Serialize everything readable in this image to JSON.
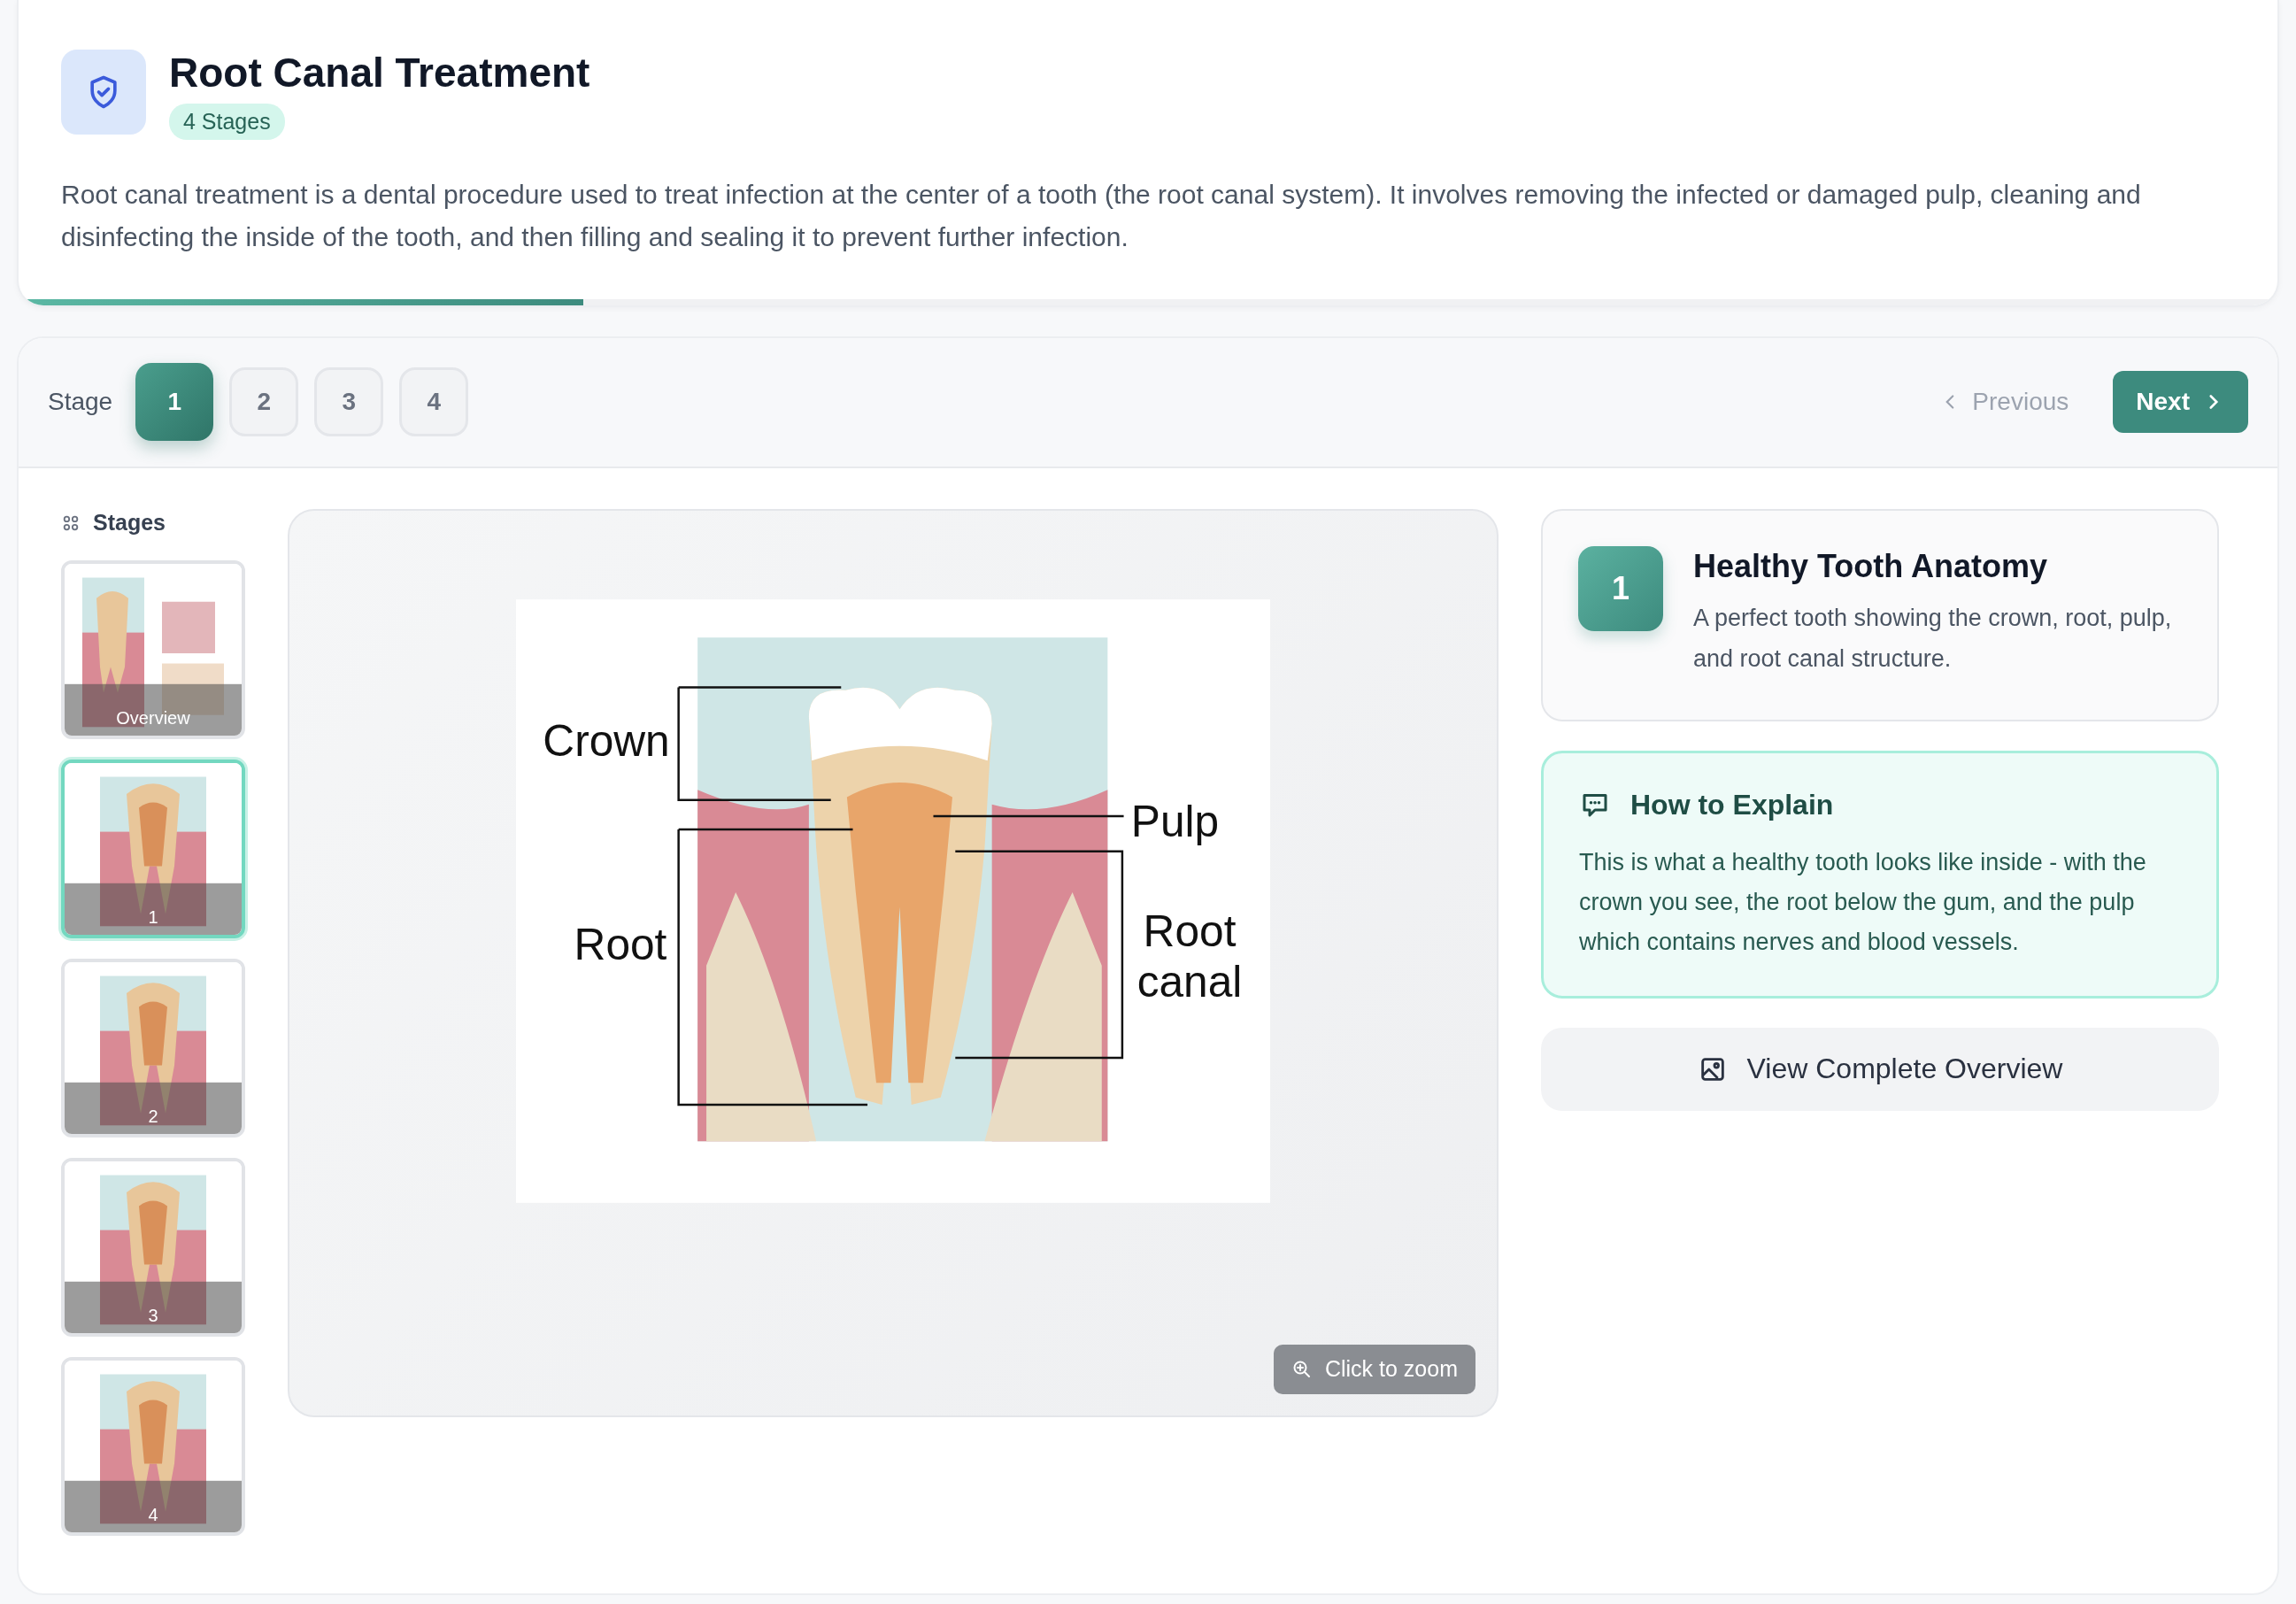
{
  "header": {
    "title": "Root Canal Treatment",
    "badge": "4 Stages",
    "description": "Root canal treatment is a dental procedure used to treat infection at the center of a tooth (the root canal system). It involves removing the infected or damaged pulp, cleaning and disinfecting the inside of the tooth, and then filling and sealing it to prevent further infection.",
    "progress": {
      "level": 0.25
    }
  },
  "stage_bar": {
    "label": "Stage",
    "stages": [
      {
        "label": "1",
        "selected": true
      },
      {
        "label": "2",
        "selected": false
      },
      {
        "label": "3",
        "selected": false
      },
      {
        "label": "4",
        "selected": false
      }
    ],
    "previous": {
      "label": "Previous",
      "disabled": true
    },
    "next": {
      "label": "Next",
      "disabled": false
    }
  },
  "sidebar": {
    "title": "Stages",
    "thumbnails": [
      {
        "caption": "Overview",
        "selected": false
      },
      {
        "caption": "1",
        "selected": true
      },
      {
        "caption": "2",
        "selected": false
      },
      {
        "caption": "3",
        "selected": false
      },
      {
        "caption": "4",
        "selected": false
      }
    ]
  },
  "diagram": {
    "labels": [
      {
        "kind": "crown",
        "text": "Crown"
      },
      {
        "kind": "pulp",
        "text": "Pulp"
      },
      {
        "kind": "root",
        "text": "Root"
      },
      {
        "kind": "canal",
        "lines": [
          "Root",
          "canal"
        ]
      }
    ],
    "zoom_button": "Click to zoom"
  },
  "stage_card": {
    "number": "1",
    "title": "Healthy Tooth Anatomy",
    "description": "A perfect tooth showing the crown, root, pulp, and root canal structure."
  },
  "explain_card": {
    "title": "How to Explain",
    "text": "This is what a healthy tooth looks like inside - with the crown you see, the root below the gum, and the pulp which contains nerves and blood vessels."
  },
  "overview_button": "View Complete Overview"
}
